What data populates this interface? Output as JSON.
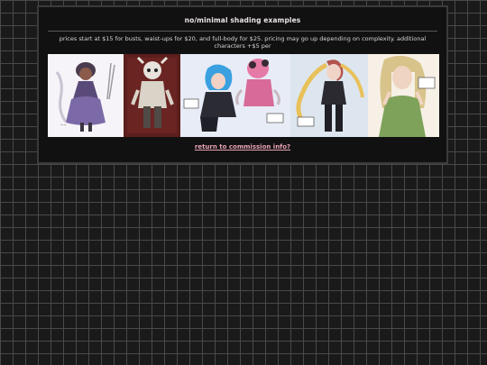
{
  "page": {
    "title": "no/minimal shading examples",
    "description": "prices start at $15 for busts, waist-ups for $20, and full-body for $25. pricing may go up depending on complexity. additional characters +$5 per",
    "return_link": "return to commission info?"
  },
  "gallery": {
    "images": [
      {
        "name": "purple-dress-character-art"
      },
      {
        "name": "skeleton-mask-character-art"
      },
      {
        "name": "blue-hair-and-pink-creature-art"
      },
      {
        "name": "long-red-hair-character-art"
      },
      {
        "name": "blonde-hair-green-top-art"
      }
    ]
  }
}
